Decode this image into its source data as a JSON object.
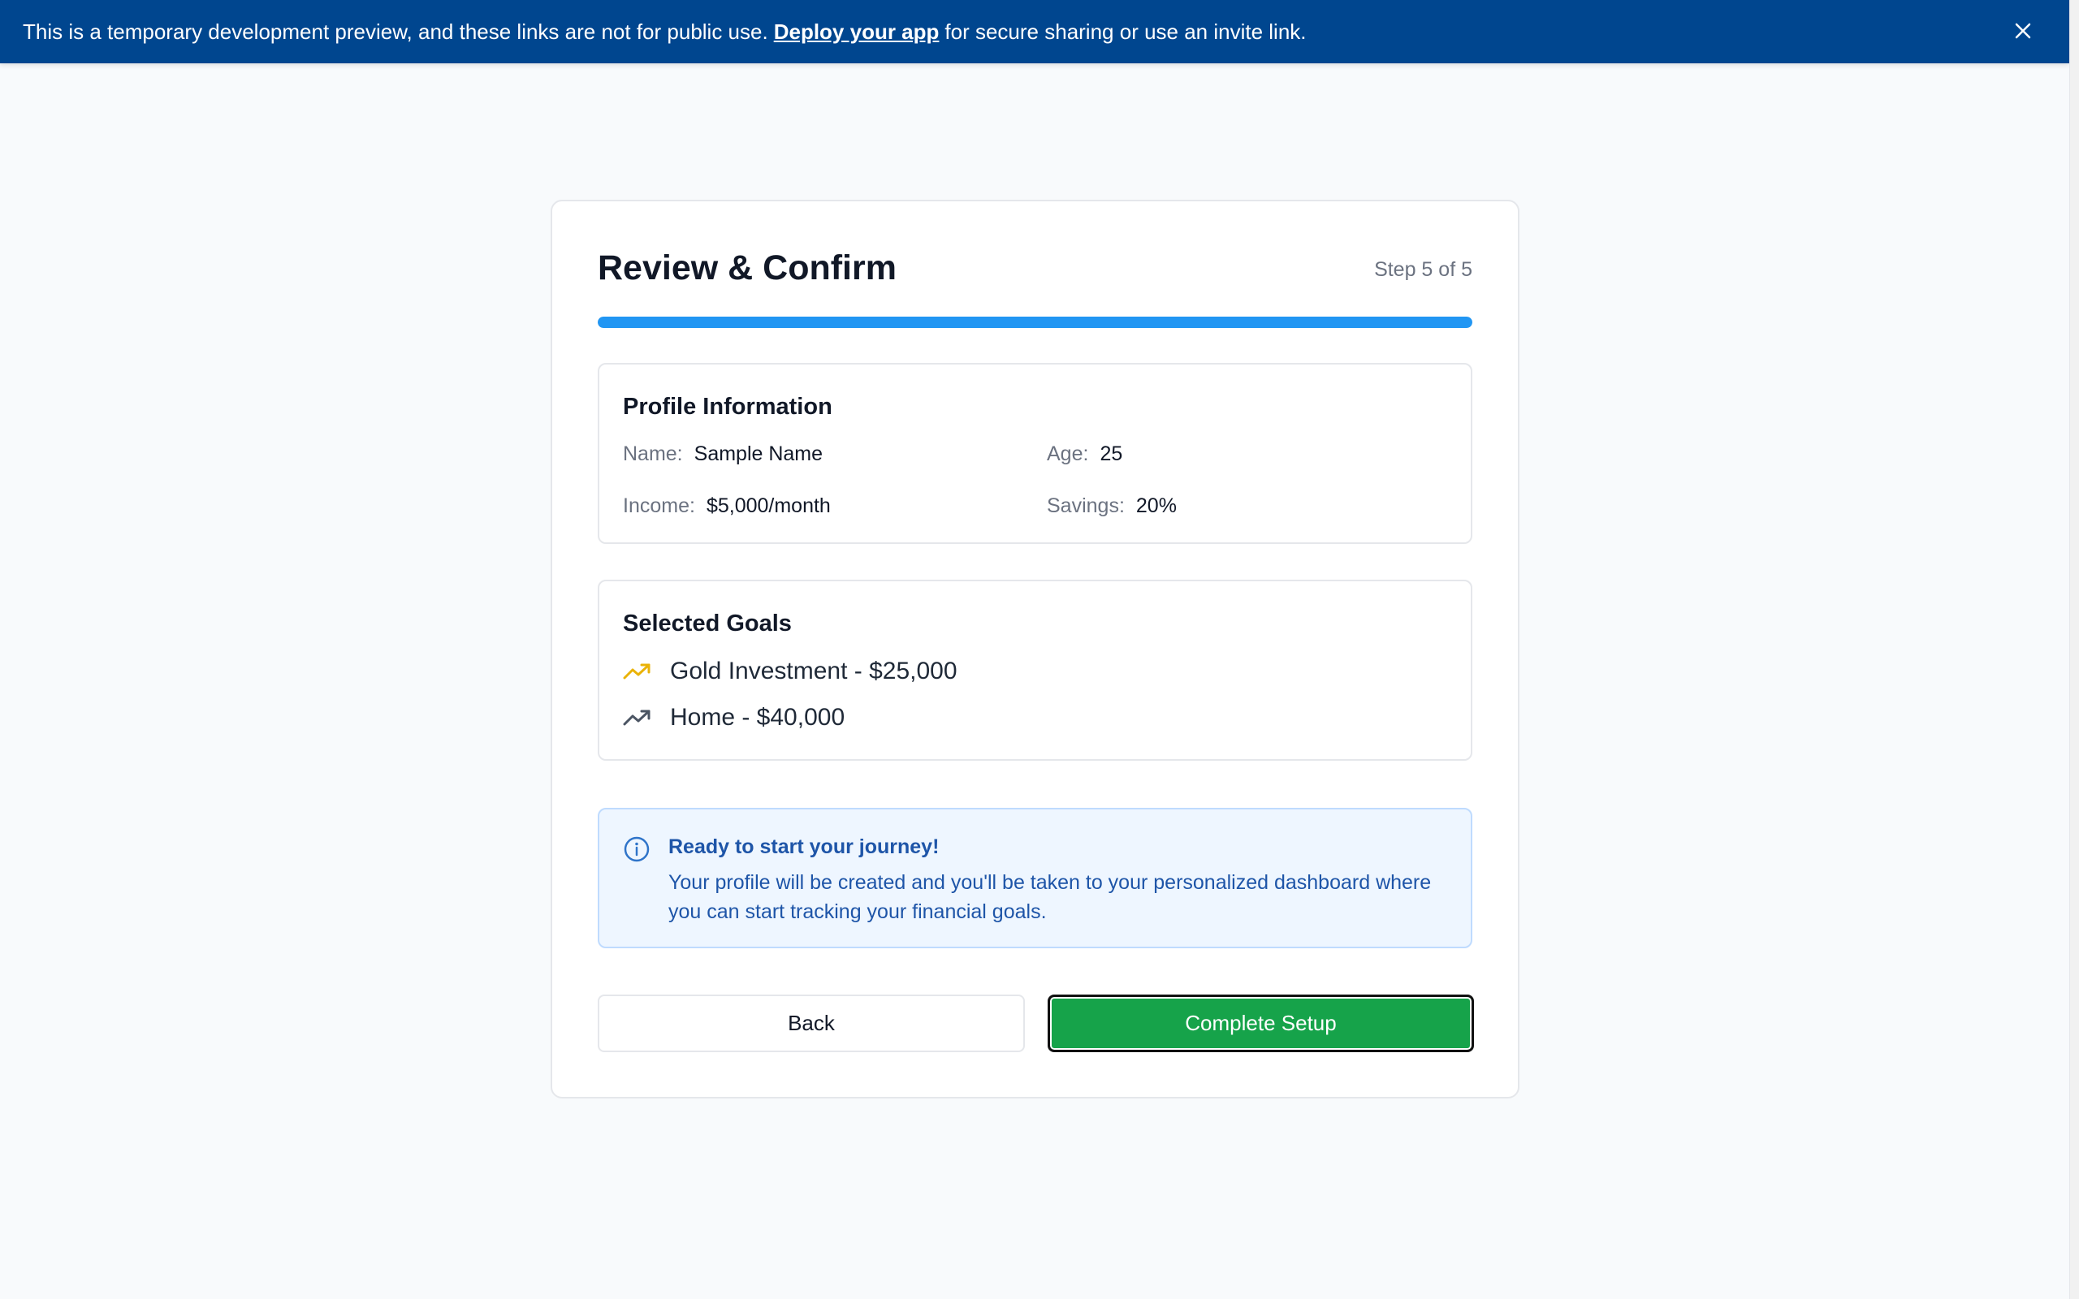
{
  "banner": {
    "text_before": "This is a temporary development preview, and these links are not for public use.",
    "link_label": "Deploy your app",
    "text_after": "for secure sharing or use an invite link.",
    "close_icon": "close-icon"
  },
  "header": {
    "title": "Review & Confirm",
    "step": "Step 5 of 5",
    "progress_percent": 100
  },
  "profile": {
    "title": "Profile Information",
    "fields": [
      {
        "label": "Name:",
        "value": "Sample Name"
      },
      {
        "label": "Age:",
        "value": "25"
      },
      {
        "label": "Income:",
        "value": "$5,000/month"
      },
      {
        "label": "Savings:",
        "value": "20%"
      }
    ]
  },
  "goals": {
    "title": "Selected Goals",
    "items": [
      {
        "label": "Gold Investment - $25,000",
        "icon": "trending-up-icon",
        "color": "#eab308"
      },
      {
        "label": "Home - $40,000",
        "icon": "trending-up-icon",
        "color": "#4b5563"
      }
    ]
  },
  "info": {
    "icon": "info-icon",
    "title": "Ready to start your journey!",
    "text": "Your profile will be created and you'll be taken to your personalized dashboard where you can start tracking your financial goals."
  },
  "actions": {
    "back_label": "Back",
    "complete_label": "Complete Setup"
  },
  "colors": {
    "banner": "#00468f",
    "progress": "#2196f3",
    "complete_button": "#16a34a",
    "info_background": "#eef6ff",
    "info_text": "#1e55a8"
  }
}
